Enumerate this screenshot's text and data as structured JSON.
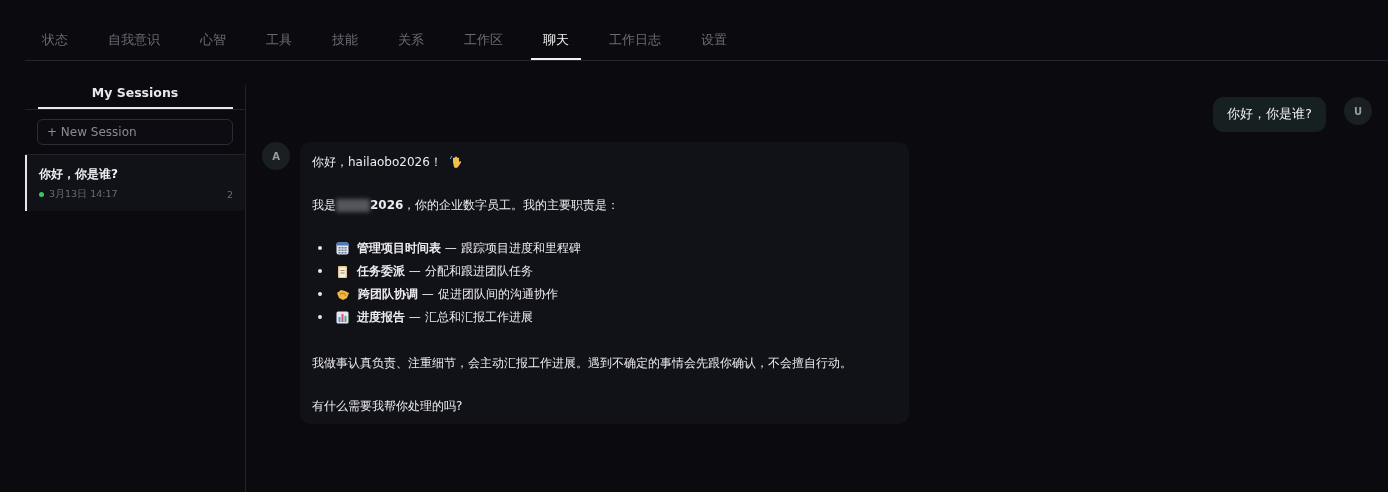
{
  "tabs": [
    {
      "label": "状态",
      "selected": false
    },
    {
      "label": "自我意识",
      "selected": false
    },
    {
      "label": "心智",
      "selected": false
    },
    {
      "label": "工具",
      "selected": false
    },
    {
      "label": "技能",
      "selected": false
    },
    {
      "label": "关系",
      "selected": false
    },
    {
      "label": "工作区",
      "selected": false
    },
    {
      "label": "聊天",
      "selected": true
    },
    {
      "label": "工作日志",
      "selected": false
    },
    {
      "label": "设置",
      "selected": false
    }
  ],
  "sidebar": {
    "title": "My Sessions",
    "new_session_button": "+ New Session",
    "sessions": [
      {
        "title": "你好，你是谁?",
        "time": "3月13日 14:17",
        "count": "2",
        "online": true,
        "selected": true
      }
    ]
  },
  "messages": [
    {
      "kind": "user",
      "avatar": "U",
      "text": "你好，你是谁?"
    },
    {
      "kind": "assistant",
      "avatar": "A",
      "greeting": "你好，hailaobo2026！",
      "intro": {
        "before": "我是",
        "redacted": true,
        "after": "**2026**，你的企业数字员工。我的主要职责是："
      },
      "duties": [
        {
          "kind": "calendar",
          "text": "**管理项目时间表** — 跟踪项目进度和里程碑"
        },
        {
          "kind": "clipboard",
          "text": "**任务委派** — 分配和跟进团队任务"
        },
        {
          "kind": "handshake",
          "text": "**跨团队协调** — 促进团队间的沟通协作"
        },
        {
          "kind": "chart",
          "text": "**进度报告** — 汇总和汇报工作进展"
        }
      ],
      "closing": "我做事认真负责、注重细节，会主动汇报工作进展。遇到不确定的事情会先跟你确认，不会擅自行动。",
      "question": "有什么需要我帮你处理的吗?"
    }
  ]
}
